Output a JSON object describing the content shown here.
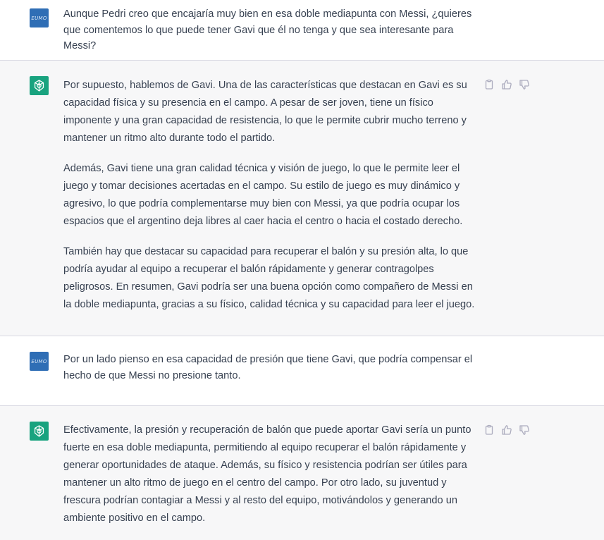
{
  "user_avatar_text": "EUMO",
  "messages": [
    {
      "role": "user",
      "paragraphs": [
        "Aunque Pedri creo que encajaría muy bien en esa doble mediapunta con Messi, ¿quieres que comentemos lo que puede tener Gavi que él no tenga y que sea interesante para Messi?"
      ]
    },
    {
      "role": "assistant",
      "paragraphs": [
        "Por supuesto, hablemos de Gavi. Una de las características que destacan en Gavi es su capacidad física y su presencia en el campo. A pesar de ser joven, tiene un físico imponente y una gran capacidad de resistencia, lo que le permite cubrir mucho terreno y mantener un ritmo alto durante todo el partido.",
        "Además, Gavi tiene una gran calidad técnica y visión de juego, lo que le permite leer el juego y tomar decisiones acertadas en el campo. Su estilo de juego es muy dinámico y agresivo, lo que podría complementarse muy bien con Messi, ya que podría ocupar los espacios que el argentino deja libres al caer hacia el centro o hacia el costado derecho.",
        "También hay que destacar su capacidad para recuperar el balón y su presión alta, lo que podría ayudar al equipo a recuperar el balón rápidamente y generar contragolpes peligrosos. En resumen, Gavi podría ser una buena opción como compañero de Messi en la doble mediapunta, gracias a su físico, calidad técnica y su capacidad para leer el juego."
      ]
    },
    {
      "role": "user",
      "paragraphs": [
        "Por un lado pienso en esa capacidad de presión que tiene Gavi, que podría compensar el hecho de que Messi no presione tanto."
      ]
    },
    {
      "role": "assistant",
      "paragraphs": [
        "Efectivamente, la presión y recuperación de balón que puede aportar Gavi sería un punto fuerte en esa doble mediapunta, permitiendo al equipo recuperar el balón rápidamente y generar oportunidades de ataque. Además, su físico y resistencia podrían ser útiles para mantener un alto ritmo de juego en el centro del campo. Por otro lado, su juventud y frescura podrían contagiar a Messi y al resto del equipo, motivándolos y generando un ambiente positivo en el campo."
      ]
    }
  ],
  "icons": {
    "copy": "clipboard-icon",
    "like": "thumbs-up-icon",
    "dislike": "thumbs-down-icon"
  }
}
